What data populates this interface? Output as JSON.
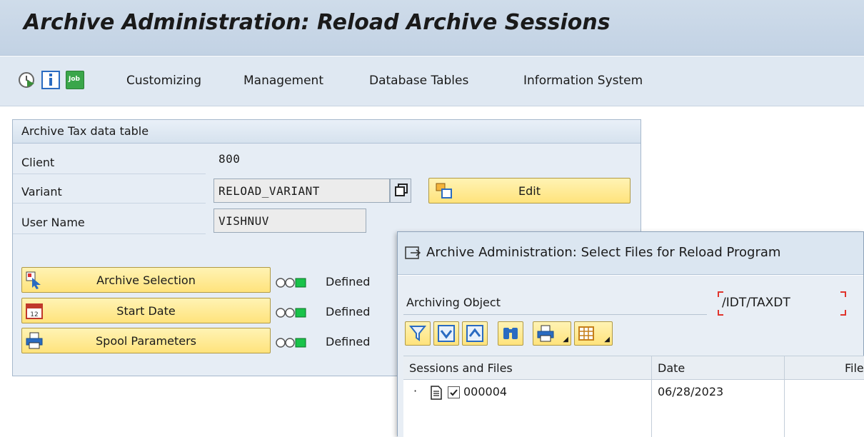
{
  "title": "Archive Administration: Reload Archive Sessions",
  "toolbar": {
    "icons": [
      "execute-clock-icon",
      "info-icon",
      "job-icon"
    ],
    "job_icon_text": "Job",
    "menu": [
      "Customizing",
      "Management",
      "Database Tables",
      "Information System"
    ]
  },
  "panel": {
    "header": "Archive Tax data table",
    "client_label": "Client",
    "client_value": "800",
    "variant_label": "Variant",
    "variant_value": "RELOAD_VARIANT",
    "edit_button": "Edit",
    "user_label": "User Name",
    "user_value": "VISHNUV",
    "actions": [
      {
        "label": "Archive Selection",
        "icon": "selection-cursor-icon",
        "status": "Defined"
      },
      {
        "label": "Start Date",
        "icon": "calendar-icon",
        "status": "Defined"
      },
      {
        "label": "Spool Parameters",
        "icon": "printer-icon",
        "status": "Defined"
      }
    ]
  },
  "popup": {
    "title": "Archive Administration: Select Files for Reload Program",
    "archiving_object_label": "Archiving Object",
    "archiving_object_value": "/IDT/TAXDT",
    "grid": {
      "columns": [
        "Sessions and Files",
        "Date",
        "File"
      ],
      "rows": [
        {
          "session": "000004",
          "checked": true,
          "date": "06/28/2023"
        }
      ]
    }
  },
  "colors": {
    "title_bar": "#c8d7e8",
    "button_yellow": "#ffe98f",
    "status_green": "#19c34a"
  }
}
